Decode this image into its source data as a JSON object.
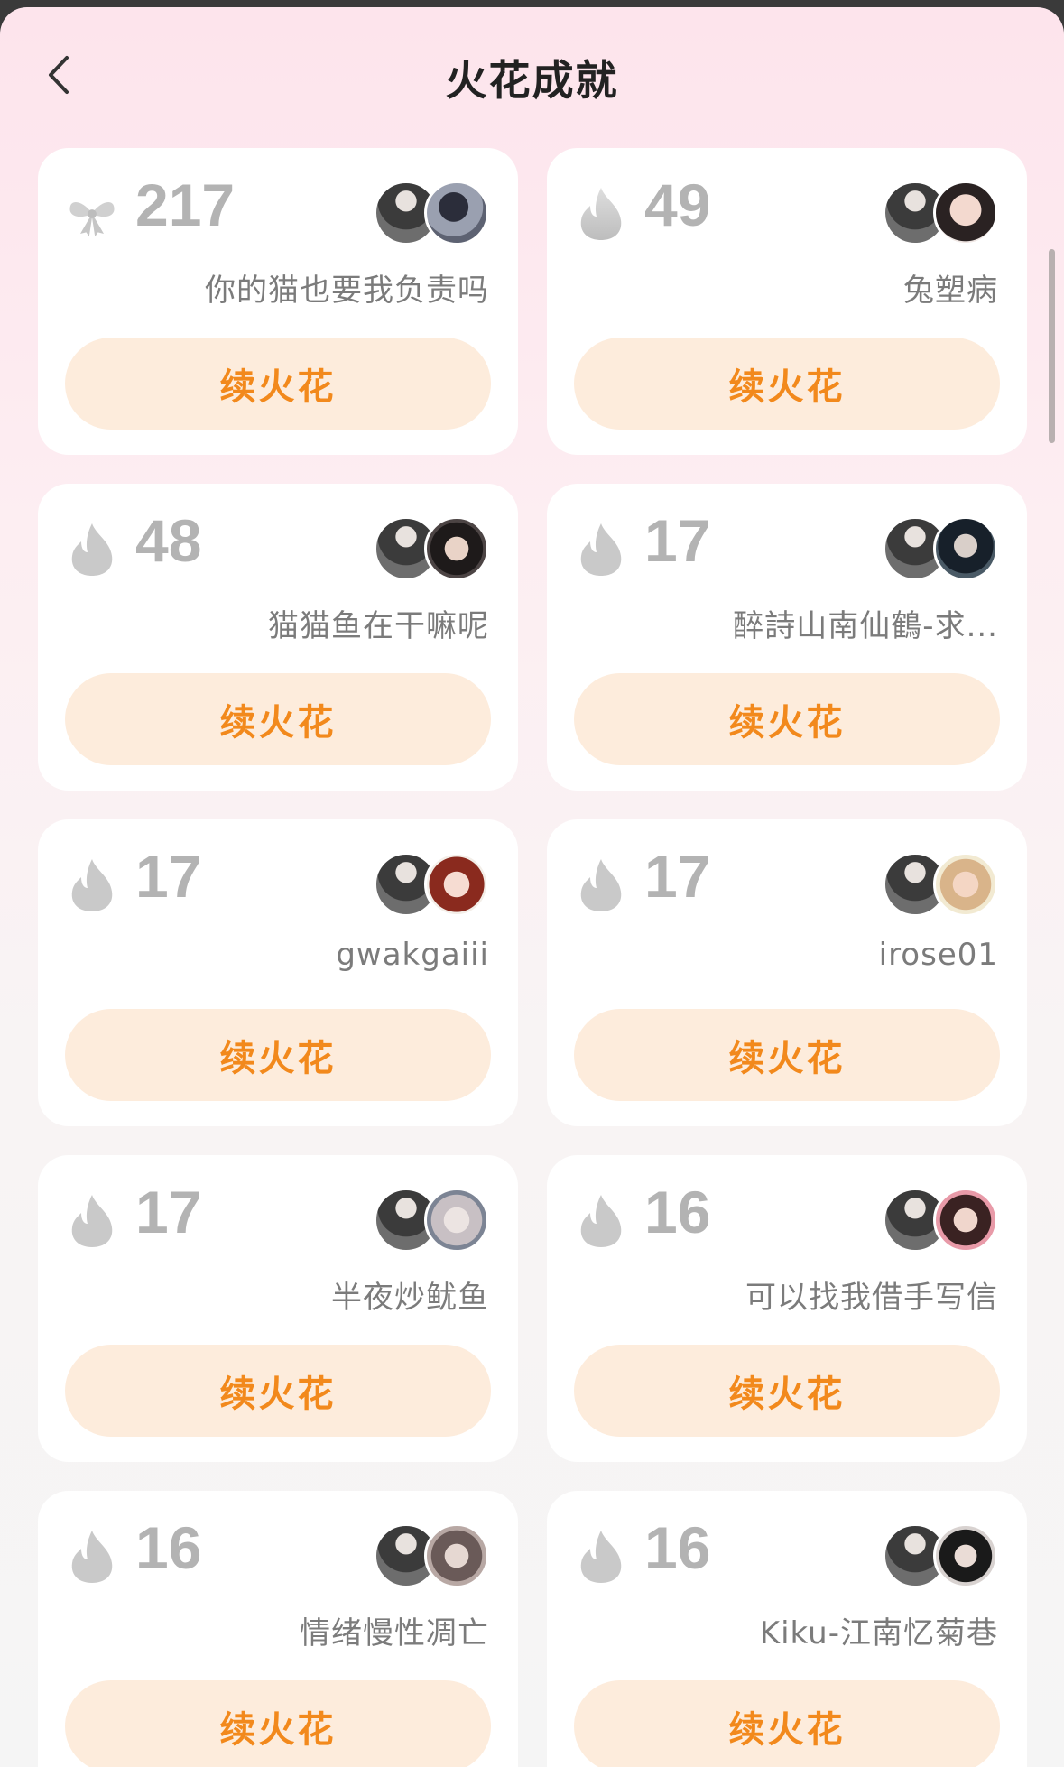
{
  "header": {
    "title": "火花成就",
    "back_icon": "chevron-left-icon"
  },
  "colors": {
    "accent": "#f2891c",
    "button_bg": "#fdecdc",
    "count_gray": "#b3b3b3"
  },
  "button_label": "续火花",
  "cards": [
    {
      "icon": "bow-icon",
      "count": "217",
      "name": "你的猫也要我负责吗"
    },
    {
      "icon": "flame-icon",
      "count": "49",
      "name": "兔塑病"
    },
    {
      "icon": "flame-icon",
      "count": "48",
      "name": "猫猫鱼在干嘛呢"
    },
    {
      "icon": "flame-icon",
      "count": "17",
      "name": "醉詩山南仙鶴-求..."
    },
    {
      "icon": "flame-icon",
      "count": "17",
      "name": "gwakgaiii"
    },
    {
      "icon": "flame-icon",
      "count": "17",
      "name": "irose01"
    },
    {
      "icon": "flame-icon",
      "count": "17",
      "name": "半夜炒鱿鱼"
    },
    {
      "icon": "flame-icon",
      "count": "16",
      "name": "可以找我借手写信"
    },
    {
      "icon": "flame-icon",
      "count": "16",
      "name": "情绪慢性凋亡"
    },
    {
      "icon": "flame-icon",
      "count": "16",
      "name": "Kiku-江南忆菊巷"
    }
  ]
}
